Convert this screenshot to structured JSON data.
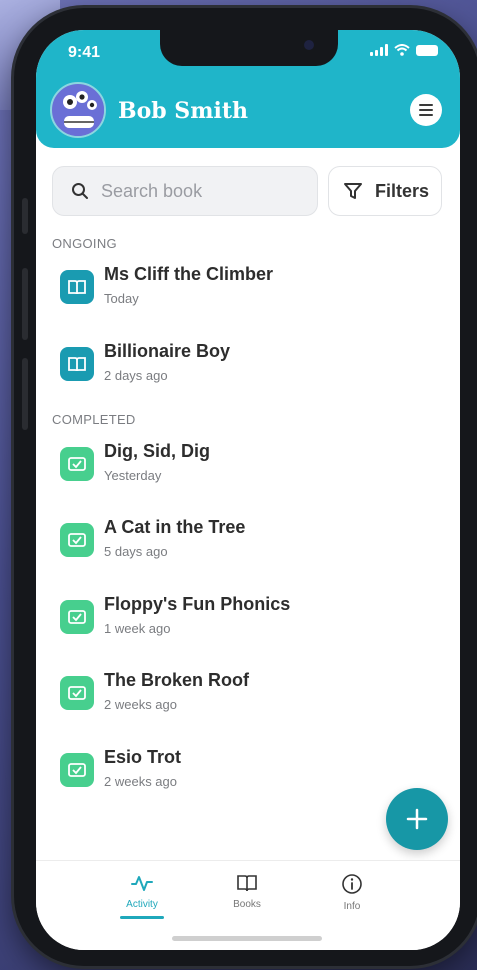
{
  "status_bar": {
    "time": "9:41"
  },
  "header": {
    "user_name": "Bob Smith"
  },
  "search": {
    "placeholder": "Search book",
    "filters_label": "Filters"
  },
  "sections": {
    "ongoing": {
      "title": "ONGOING",
      "items": [
        {
          "title": "Ms Cliff the Climber",
          "subtitle": "Today"
        },
        {
          "title": "Billionaire Boy",
          "subtitle": "2 days ago"
        }
      ]
    },
    "completed": {
      "title": "COMPLETED",
      "items": [
        {
          "title": "Dig, Sid, Dig",
          "subtitle": "Yesterday"
        },
        {
          "title": "A Cat in the Tree",
          "subtitle": "5 days ago"
        },
        {
          "title": "Floppy's Fun Phonics",
          "subtitle": "1 week ago"
        },
        {
          "title": "The Broken Roof",
          "subtitle": "2 weeks ago"
        },
        {
          "title": "Esio Trot",
          "subtitle": "2 weeks ago"
        }
      ]
    }
  },
  "tabbar": {
    "tabs": [
      {
        "label": "Activity",
        "icon": "activity-icon",
        "active": true
      },
      {
        "label": "Books",
        "icon": "book-icon",
        "active": false
      },
      {
        "label": "Info",
        "icon": "info-icon",
        "active": false
      }
    ]
  },
  "colors": {
    "header": "#1fb5c9",
    "ongoing_icon": "#1a9bb1",
    "completed_icon": "#47cf8e",
    "fab": "#1797a6",
    "accent": "#1fa8bb"
  }
}
